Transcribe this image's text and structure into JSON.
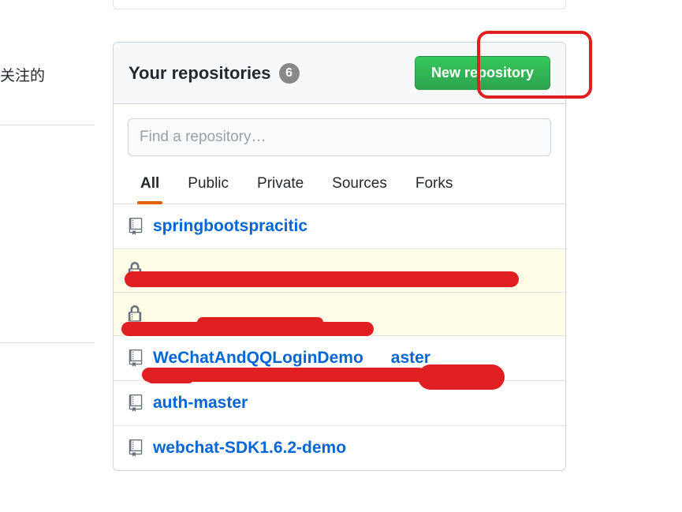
{
  "sidebar": {
    "fragment_text": "关注的"
  },
  "header": {
    "title": "Your repositories",
    "count": "6",
    "new_button": "New repository"
  },
  "search": {
    "placeholder": "Find a repository…"
  },
  "tabs": {
    "all": "All",
    "public": "Public",
    "private": "Private",
    "sources": "Sources",
    "forks": "Forks"
  },
  "repos": {
    "r0": "springbootspracitic",
    "r1": "",
    "r2": "",
    "r3_prefix": "WeChatAndQQLoginDemo",
    "r3_suffix": "aster",
    "r4": "auth-master",
    "r5": "webchat-SDK1.6.2-demo"
  }
}
